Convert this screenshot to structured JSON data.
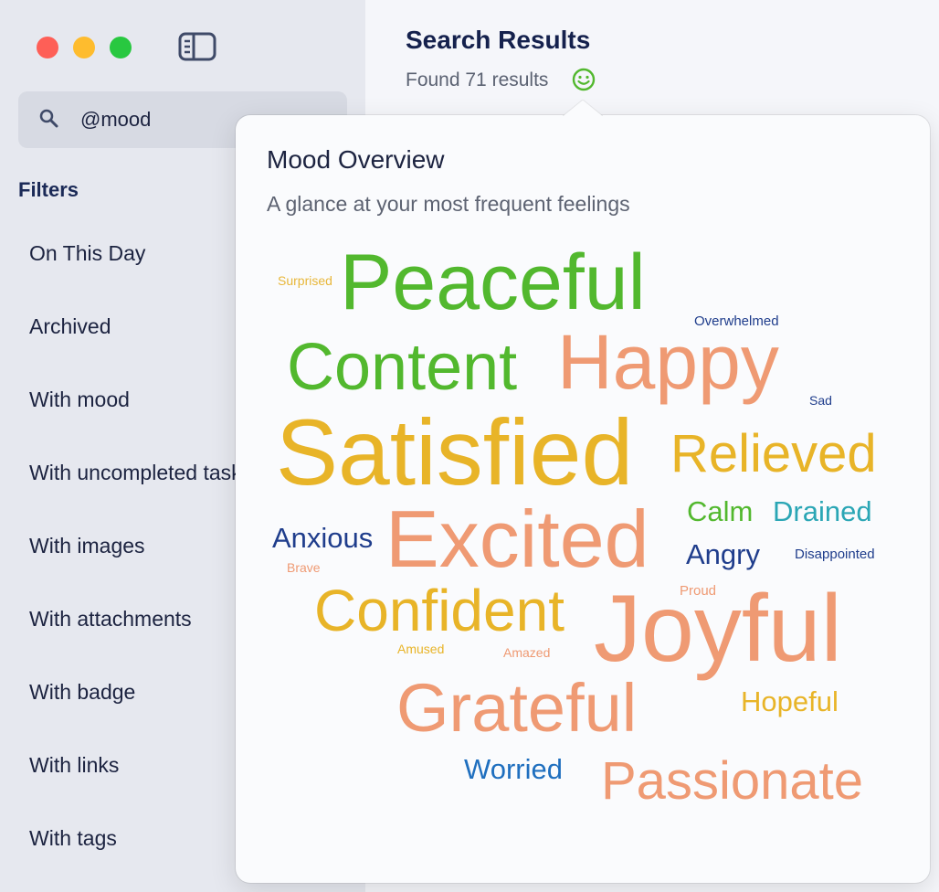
{
  "sidebar": {
    "search_query": "@mood",
    "filters_heading": "Filters",
    "filters": [
      {
        "label": "On This Day"
      },
      {
        "label": "Archived"
      },
      {
        "label": "With mood"
      },
      {
        "label": "With uncompleted tasks"
      },
      {
        "label": "With images"
      },
      {
        "label": "With attachments"
      },
      {
        "label": "With badge"
      },
      {
        "label": "With links"
      },
      {
        "label": "With tags"
      }
    ]
  },
  "main": {
    "title": "Search Results",
    "result_count": "Found 71 results",
    "mood_icon": "smiley-face-icon"
  },
  "popover": {
    "title": "Mood Overview",
    "subtitle": "A glance at your most frequent feelings",
    "words": [
      {
        "text": "Surprised",
        "color": "#e8b73a"
      },
      {
        "text": "Peaceful",
        "color": "#52b82e"
      },
      {
        "text": "Overwhelmed",
        "color": "#1f3d8c"
      },
      {
        "text": "Content",
        "color": "#52b82e"
      },
      {
        "text": "Happy",
        "color": "#ef9a73"
      },
      {
        "text": "Sad",
        "color": "#1f3d8c"
      },
      {
        "text": "Satisfied",
        "color": "#e8b428"
      },
      {
        "text": "Relieved",
        "color": "#e8b428"
      },
      {
        "text": "Calm",
        "color": "#52b82e"
      },
      {
        "text": "Drained",
        "color": "#2aa6b5"
      },
      {
        "text": "Anxious",
        "color": "#1f3d8c"
      },
      {
        "text": "Excited",
        "color": "#ef9a73"
      },
      {
        "text": "Angry",
        "color": "#1f3d8c"
      },
      {
        "text": "Disappointed",
        "color": "#1f3d8c"
      },
      {
        "text": "Brave",
        "color": "#ef9a73"
      },
      {
        "text": "Proud",
        "color": "#ef9a73"
      },
      {
        "text": "Confident",
        "color": "#e8b428"
      },
      {
        "text": "Joyful",
        "color": "#ef9a73"
      },
      {
        "text": "Amused",
        "color": "#e8b428"
      },
      {
        "text": "Amazed",
        "color": "#ef9a73"
      },
      {
        "text": "Grateful",
        "color": "#ef9a73"
      },
      {
        "text": "Hopeful",
        "color": "#e8b428"
      },
      {
        "text": "Worried",
        "color": "#1f6fbf"
      },
      {
        "text": "Passionate",
        "color": "#ef9a73"
      }
    ]
  }
}
